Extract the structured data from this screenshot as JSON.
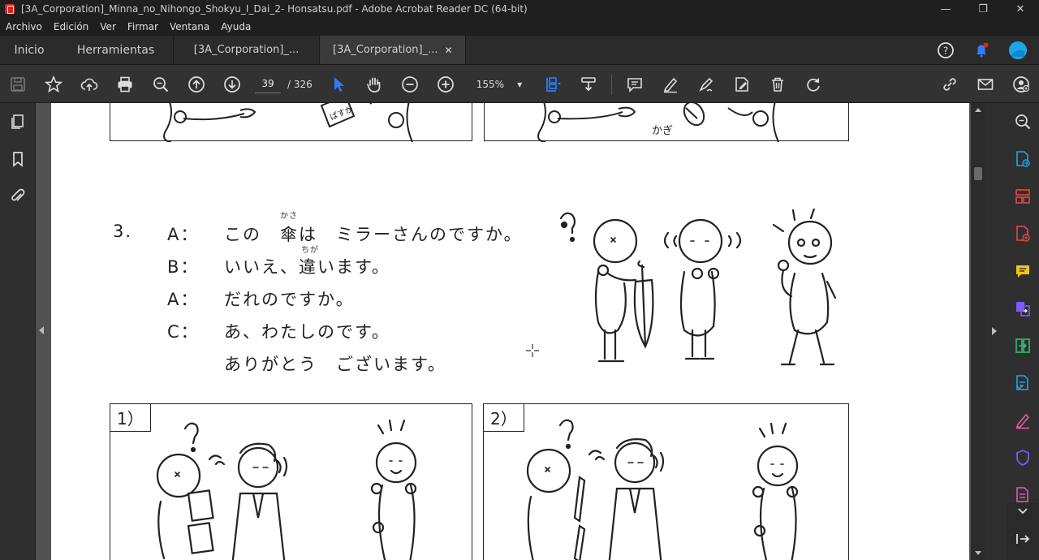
{
  "window": {
    "title": "[3A_Corporation]_Minna_no_Nihongo_Shokyu_I_Dai_2-  Honsatsu.pdf - Adobe Acrobat Reader DC (64-bit)",
    "minimize": "—",
    "restore": "❐",
    "close": "✕"
  },
  "menu": [
    "Archivo",
    "Edición",
    "Ver",
    "Firmar",
    "Ventana",
    "Ayuda"
  ],
  "tabs": {
    "home": "Inicio",
    "tools": "Herramientas",
    "doc1": "[3A_Corporation]_...",
    "doc2": "[3A_Corporation]_...",
    "doc2_close": "✕"
  },
  "toolbar": {
    "page_current": "39",
    "page_total": "/ 326",
    "zoom": "155%",
    "zoom_arrow": "▾"
  },
  "document": {
    "section_number": "3.",
    "lines": [
      {
        "speaker": "A：",
        "text": "この　傘は　ミラーさんのですか。"
      },
      {
        "speaker": "B：",
        "text": "いいえ、違います。"
      },
      {
        "speaker": "A：",
        "text": "だれのですか。"
      },
      {
        "speaker": "C：",
        "text": "あ、わたしのです。"
      },
      {
        "speaker": "",
        "text": "ありがとう　ございます。"
      }
    ],
    "furigana_kasa": "かさ",
    "furigana_chigai": "ちが",
    "top_right_caption": "かぎ",
    "panel1_label": "1）",
    "panel2_label": "2）"
  },
  "colors": {
    "accent_blue": "#2d7ff9",
    "notification_red": "#e2231a",
    "avatar_cyan": "#1ea7e8"
  }
}
